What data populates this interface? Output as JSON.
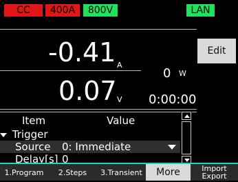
{
  "status": {
    "cc": "CC",
    "current_limit": "400A",
    "voltage_limit": "800V",
    "network": "LAN"
  },
  "readout": {
    "current_value": "-0.41",
    "current_unit": "A",
    "voltage_value": "0.07",
    "voltage_unit": "V",
    "power_value": "0",
    "power_unit": "W",
    "elapsed_time": "0:00:00"
  },
  "actions": {
    "edit": "Edit"
  },
  "table": {
    "headers": [
      "Item",
      "Value"
    ],
    "group_label": "Trigger",
    "rows": [
      {
        "item": "Source",
        "value": "0: Immediate"
      },
      {
        "item": "Delay[s]",
        "value": "0"
      }
    ]
  },
  "footer": {
    "tabs": [
      "1.Program",
      "2.Steps",
      "3.Transient"
    ],
    "more": "More",
    "import_export": [
      "Import",
      "Export"
    ]
  },
  "colors": {
    "red": "#e01717",
    "green": "#1ee35d",
    "accent": "#2ad1c7",
    "selected_row": "#2f2f2f"
  }
}
